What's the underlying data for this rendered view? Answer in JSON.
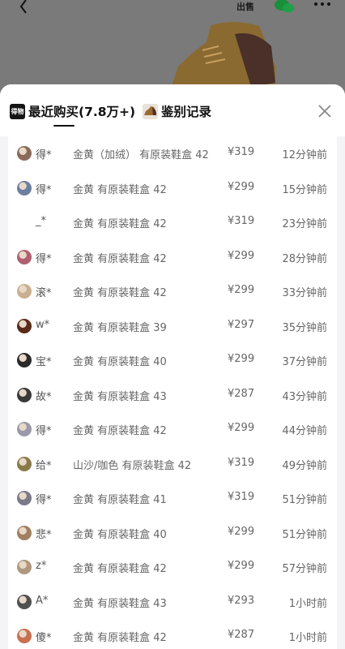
{
  "background": {
    "sell_label": "出售"
  },
  "tabs": [
    {
      "label": "最近购买(7.8万+)",
      "icon_text": "得物",
      "active": true
    },
    {
      "label": "鉴别记录",
      "active": false
    }
  ],
  "purchases": [
    {
      "name": "得*",
      "spec": "金黄（加绒） 有原装鞋盒 42",
      "price": "¥319",
      "time": "12分钟前",
      "avatar_color": "#8a6a5a"
    },
    {
      "name": "得*",
      "spec": "金黄 有原装鞋盒 42",
      "price": "¥299",
      "time": "15分钟前",
      "avatar_color": "#6b7fa0"
    },
    {
      "name": "_*",
      "spec": "金黄 有原装鞋盒 42",
      "price": "¥319",
      "time": "23分钟前",
      "avatar_color": ""
    },
    {
      "name": "得*",
      "spec": "金黄 有原装鞋盒 42",
      "price": "¥299",
      "time": "28分钟前",
      "avatar_color": "#b06070"
    },
    {
      "name": "滚*",
      "spec": "金黄 有原装鞋盒 42",
      "price": "¥299",
      "time": "33分钟前",
      "avatar_color": "#c8b090"
    },
    {
      "name": "w*",
      "spec": "金黄 有原装鞋盒 39",
      "price": "¥297",
      "time": "35分钟前",
      "avatar_color": "#5a2a1a"
    },
    {
      "name": "宝*",
      "spec": "金黄 有原装鞋盒 40",
      "price": "¥299",
      "time": "37分钟前",
      "avatar_color": "#2a2a2a"
    },
    {
      "name": "故*",
      "spec": "金黄 有原装鞋盒 43",
      "price": "¥287",
      "time": "43分钟前",
      "avatar_color": "#3a3a3a"
    },
    {
      "name": "得*",
      "spec": "金黄 有原装鞋盒 42",
      "price": "¥299",
      "time": "44分钟前",
      "avatar_color": "#9a9aa8"
    },
    {
      "name": "给*",
      "spec": "山沙/咖色 有原装鞋盒 42",
      "price": "¥319",
      "time": "49分钟前",
      "avatar_color": "#8a7a4a"
    },
    {
      "name": "得*",
      "spec": "金黄 有原装鞋盒 41",
      "price": "¥319",
      "time": "51分钟前",
      "avatar_color": "#7a7a88"
    },
    {
      "name": "悲*",
      "spec": "金黄 有原装鞋盒 40",
      "price": "¥299",
      "time": "51分钟前",
      "avatar_color": "#a08060"
    },
    {
      "name": "z*",
      "spec": "金黄 有原装鞋盒 42",
      "price": "¥299",
      "time": "57分钟前",
      "avatar_color": "#b09880"
    },
    {
      "name": "A*",
      "spec": "金黄 有原装鞋盒 43",
      "price": "¥293",
      "time": "1小时前",
      "avatar_color": "#505050"
    },
    {
      "name": "傻*",
      "spec": "金黄 有原装鞋盒 42",
      "price": "¥287",
      "time": "1小时前",
      "avatar_color": "#c87050"
    }
  ]
}
